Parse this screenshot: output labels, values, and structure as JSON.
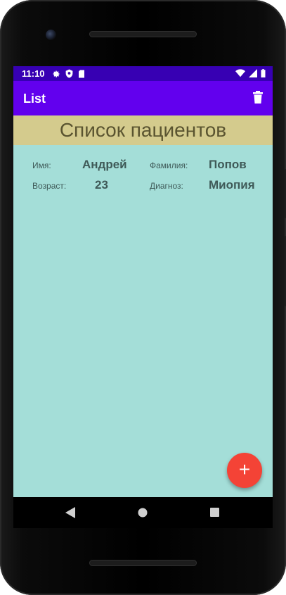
{
  "status_bar": {
    "time": "11:10",
    "left_icons": [
      "gear-icon",
      "shield-icon",
      "sd-card-icon"
    ],
    "right_icons": [
      "wifi-icon",
      "signal-icon",
      "battery-icon"
    ]
  },
  "app_bar": {
    "title": "List",
    "action_icon": "trash-icon"
  },
  "header": {
    "title": "Список пациентов"
  },
  "patient": {
    "name_label": "Имя:",
    "name_value": "Андрей",
    "surname_label": "Фамилия:",
    "surname_value": "Попов",
    "age_label": "Возраст:",
    "age_value": "23",
    "diagnosis_label": "Диагноз:",
    "diagnosis_value": "Миопия"
  },
  "fab": {
    "label": "+",
    "color": "#f44336"
  },
  "colors": {
    "status_bar": "#3700b3",
    "app_bar": "#6200ee",
    "background": "#a4ded8",
    "banner": "#d4cb8d",
    "banner_text": "#5a5430",
    "text": "#3f5a58"
  },
  "nav_bar": {
    "icons": [
      "back-icon",
      "home-icon",
      "recents-icon"
    ]
  }
}
